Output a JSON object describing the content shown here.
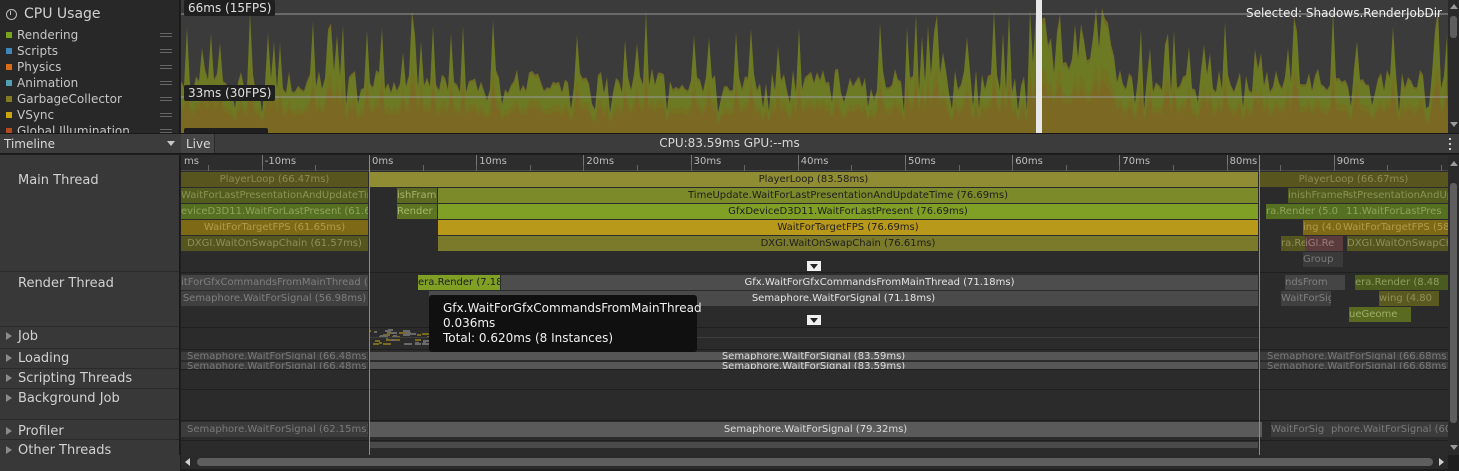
{
  "colors": {
    "rendering": "#79a11b",
    "scripts": "#3e87b9",
    "physics": "#d96c14",
    "animation": "#4f9fb5",
    "gc": "#7b7020",
    "vsync": "#c7a50b",
    "gi": "#b34b1d",
    "playerloop": "#8f8c33",
    "timeupdate": "#7c8a2a",
    "gfxdevice": "#7fa025",
    "targetfps": "#b9991a",
    "swapchain": "#7a7a2a",
    "semaphore": "#626262"
  },
  "legend": {
    "title": "CPU Usage",
    "title_icon": "cpu-icon",
    "items": [
      {
        "label": "Rendering",
        "color": "#7aa31c"
      },
      {
        "label": "Scripts",
        "color": "#3e87b9"
      },
      {
        "label": "Physics",
        "color": "#d96c14"
      },
      {
        "label": "Animation",
        "color": "#4f9fb5"
      },
      {
        "label": "GarbageCollector",
        "color": "#837a26"
      },
      {
        "label": "VSync",
        "color": "#c7a50b"
      },
      {
        "label": "Global Illumination",
        "color": "#b34b1d"
      }
    ]
  },
  "chart": {
    "label_top": "66ms (15FPS)",
    "label_mid": "33ms (30FPS)",
    "selected": "Selected: Shadows.RenderJobDir"
  },
  "toolbar": {
    "view_mode": "Timeline",
    "live": "Live",
    "cpu_gpu": "CPU:83.59ms   GPU:--ms"
  },
  "threads": {
    "main": "Main Thread",
    "render": "Render Thread",
    "job": "Job",
    "loading": "Loading",
    "scripting": "Scripting Threads",
    "background": "Background Job",
    "profiler": "Profiler",
    "other": "Other Threads"
  },
  "ruler": {
    "labels": [
      "ms",
      "-10ms",
      "0ms",
      "10ms",
      "20ms",
      "30ms",
      "40ms",
      "50ms",
      "60ms",
      "70ms",
      "80ms",
      "90ms"
    ]
  },
  "bars": {
    "main": {
      "row0": {
        "left": "PlayerLoop (66.47ms)",
        "mid": "PlayerLoop (83.58ms)",
        "right": "PlayerLoop (66.67ms)"
      },
      "row1": {
        "left": "WaitForLastPresentationAndUpdateTim",
        "left2": "ishFrame",
        "mid": "TimeUpdate.WaitForLastPresentationAndUpdateTime (76.69ms)",
        "right": "inishFrameRe",
        "right2": "stPresentationAndUpd"
      },
      "row2": {
        "left": "eviceD3D11.WaitForLastPresent (61.6",
        "left2": "Render",
        "mid": "GfxDeviceD3D11.WaitForLastPresent (76.69ms)",
        "right": "ra.Render (5.0",
        "right2": "11.WaitForLastPres"
      },
      "row3": {
        "left": "WaitForTargetFPS (61.65ms)",
        "mid": "WaitForTargetFPS (76.69ms)",
        "right": "ing (4.0",
        "right2": "WaitForTargetFPS (58.02"
      },
      "row4": {
        "left": "DXGI.WaitOnSwapChain (61.57ms)",
        "mid": "DXGI.WaitOnSwapChain (76.61ms)",
        "right": "ra.Render",
        "right2": "iGI.Re",
        "right3": "DXGI.WaitOnSwapChain (57"
      },
      "row5": {
        "right": "Group"
      }
    },
    "render": {
      "row0": {
        "left": "itForGfxCommandsFromMainThread (56",
        "left2": "era.Render (7.18",
        "mid": "Gfx.WaitForGfxCommandsFromMainThread (71.18ms)",
        "right": "ndsFrom",
        "right2": "era.Render (8.48"
      },
      "row1": {
        "left": "Semaphore.WaitForSignal (56.98ms)",
        "mid": "Semaphore.WaitForSignal (71.18ms)",
        "right": "WaitForSig",
        "right2": "wing (4.80"
      },
      "row2": {
        "right": "ueGeome"
      }
    },
    "loading": {
      "row0": {
        "left": "Semaphore.WaitForSignal (66.48ms)",
        "mid": "Semaphore.WaitForSignal (83.59ms)",
        "right": "Semaphore.WaitForSignal (66.68ms)"
      },
      "row1": {
        "left": "Semaphore.WaitForSignal (66.48ms)",
        "mid": "Semaphore.WaitForSignal (83.59ms)",
        "right": "Semaphore.WaitForSignal (66.68ms)"
      }
    },
    "profiler": {
      "left": "Semaphore.WaitForSignal (62.15ms)",
      "mid": "Semaphore.WaitForSignal (79.32ms)",
      "right": "WaitForSig",
      "right2": "phore.WaitForSignal (60.5"
    }
  },
  "tooltip": {
    "name": "Gfx.WaitForGfxCommandsFromMainThread",
    "time": "0.036ms",
    "total": "Total: 0.620ms (8 Instances)"
  }
}
